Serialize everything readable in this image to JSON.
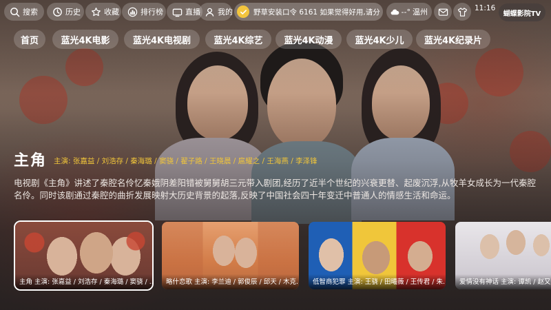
{
  "topbar": {
    "search_label": "搜索",
    "history_label": "历史",
    "favorites_label": "收藏",
    "ranking_label": "排行榜",
    "live_label": "直播",
    "mine_label": "我的",
    "notice_text": "野草安装口令 6161 如果觉得好用,请分",
    "weather_temp": "--°",
    "weather_city": "温州",
    "clock": "11:16",
    "brand": "蝴蝶影院TV"
  },
  "tabs": [
    "首页",
    "蓝光4K电影",
    "蓝光4K电视剧",
    "蓝光4K综艺",
    "蓝光4K动漫",
    "蓝光4K少儿",
    "蓝光4K纪录片"
  ],
  "featured": {
    "title": "主角",
    "cast": "主演: 张嘉益 / 刘浩存 / 秦海璐 / 窦骁 / 翟子路 / 王晓晨 / 扈耀之 / 王海燕 / 李泽锋",
    "description": "电视剧《主角》讲述了秦腔名伶忆秦娥阴差阳错被舅舅胡三元带入剧团,经历了近半个世纪的兴衰更替、起废沉浮,从牧羊女成长为一代秦腔名伶。同时该剧通过秦腔的曲折发展映射大历史背景的起落,反映了中国社会四十年变迁中普通人的情感生活和命运。"
  },
  "cards": [
    {
      "caption": "主角   主演: 张嘉益 / 刘浩存 / 秦海璐 / 窦骁 / ..."
    },
    {
      "caption": "略什恋歌   主演: 李兰迪 / 郭俊辰 / 邱天 / 木克..."
    },
    {
      "caption": "低智商犯罪   主演: 王骁 / 田曦薇 / 王传君 / 朱..."
    },
    {
      "caption": "爱情没有神话   主演: 谭凯 / 赵又..."
    }
  ],
  "colors": {
    "accent_gold": "#f0c53a",
    "notice_badge": "#f3c53e"
  }
}
